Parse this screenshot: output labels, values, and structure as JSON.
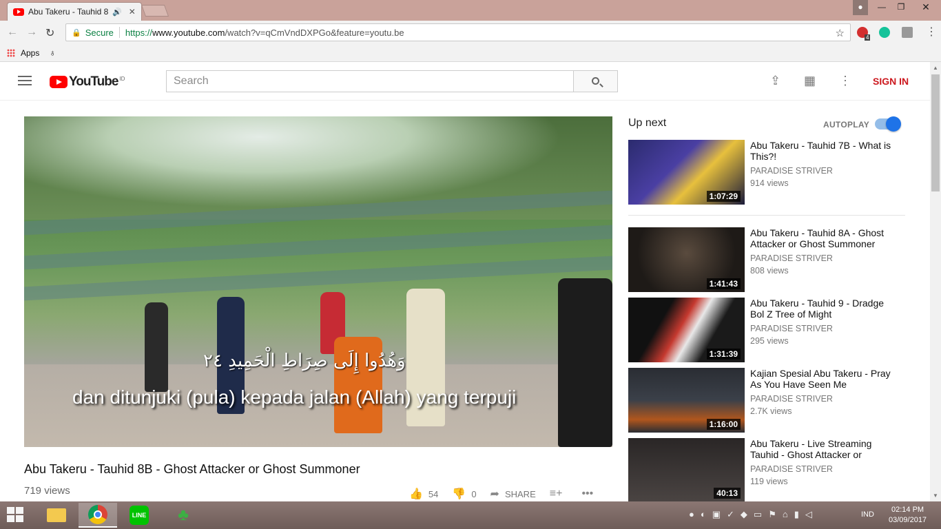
{
  "browser": {
    "tab_title": "Abu Takeru - Tauhid 8",
    "tab_audio_icon": "speaker-icon",
    "omnibox": {
      "secure_label": "Secure",
      "url_scheme": "https://",
      "url_host": "www.youtube.com",
      "url_path": "/watch?v=qCmVndDXPGo&feature=youtu.be"
    },
    "bookmarks": {
      "apps_label": "Apps"
    },
    "extension_badge": "4"
  },
  "youtube": {
    "logo_text": "YouTube",
    "country_code": "ID",
    "search_placeholder": "Search",
    "sign_in": "SIGN IN"
  },
  "video": {
    "subtitle_arabic": "وَهُدُوا إِلَى صِرَاطِ الْحَمِيدِ ٢٤",
    "subtitle_indonesian": "dan ditunjuki (pula) kepada jalan (Allah) yang terpuji",
    "title": "Abu Takeru - Tauhid 8B - Ghost Attacker or Ghost Summoner",
    "views": "719 views",
    "likes": "54",
    "dislikes": "0",
    "share_label": "SHARE",
    "progress_fraction": 0
  },
  "sidebar": {
    "up_next": "Up next",
    "autoplay_label": "AUTOPLAY",
    "autoplay_on": true,
    "items": [
      {
        "title": "Abu Takeru - Tauhid 7B - What is This?!",
        "channel": "PARADISE STRIVER",
        "views": "914 views",
        "duration": "1:07:29"
      },
      {
        "title": "Abu Takeru - Tauhid 8A - Ghost Attacker or Ghost Summoner",
        "channel": "PARADISE STRIVER",
        "views": "808 views",
        "duration": "1:41:43"
      },
      {
        "title": "Abu Takeru - Tauhid 9 - Dradge Bol Z Tree of Might",
        "channel": "PARADISE STRIVER",
        "views": "295 views",
        "duration": "1:31:39"
      },
      {
        "title": "Kajian Spesial Abu Takeru - Pray As You Have Seen Me",
        "channel": "PARADISE STRIVER",
        "views": "2.7K views",
        "duration": "1:16:00"
      },
      {
        "title": "Abu Takeru - Live Streaming Tauhid - Ghost Attacker or",
        "channel": "PARADISE STRIVER",
        "views": "119 views",
        "duration": "40:13"
      }
    ]
  },
  "taskbar": {
    "language": "IND",
    "time": "02:14 PM",
    "date": "03/09/2017"
  },
  "colors": {
    "youtube_red": "#ff0000",
    "signin_red": "#cc181e",
    "toggle_blue": "#1e73e8",
    "secure_green": "#0b8043"
  }
}
